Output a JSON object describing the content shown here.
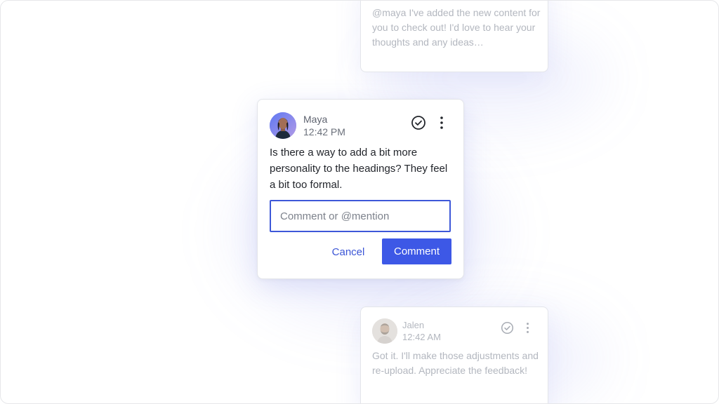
{
  "top_card": {
    "message": "@maya I've added the new content for you to check out! I'd love to hear your thoughts and any ideas…"
  },
  "main_card": {
    "author": "Maya",
    "time": "12:42 PM",
    "message": "Is there a way to add a bit more personality to the headings? They feel a bit too formal.",
    "input_placeholder": "Comment or @mention",
    "input_value": "",
    "cancel_label": "Cancel",
    "comment_label": "Comment",
    "accent_color": "#3d58e6"
  },
  "bottom_card": {
    "author": "Jalen",
    "time": "12:42 AM",
    "message": "Got it. I'll make those adjustments and re-upload. Appreciate the feedback!"
  },
  "icons": {
    "resolve": "check-circle-icon",
    "more": "more-vertical-icon"
  }
}
